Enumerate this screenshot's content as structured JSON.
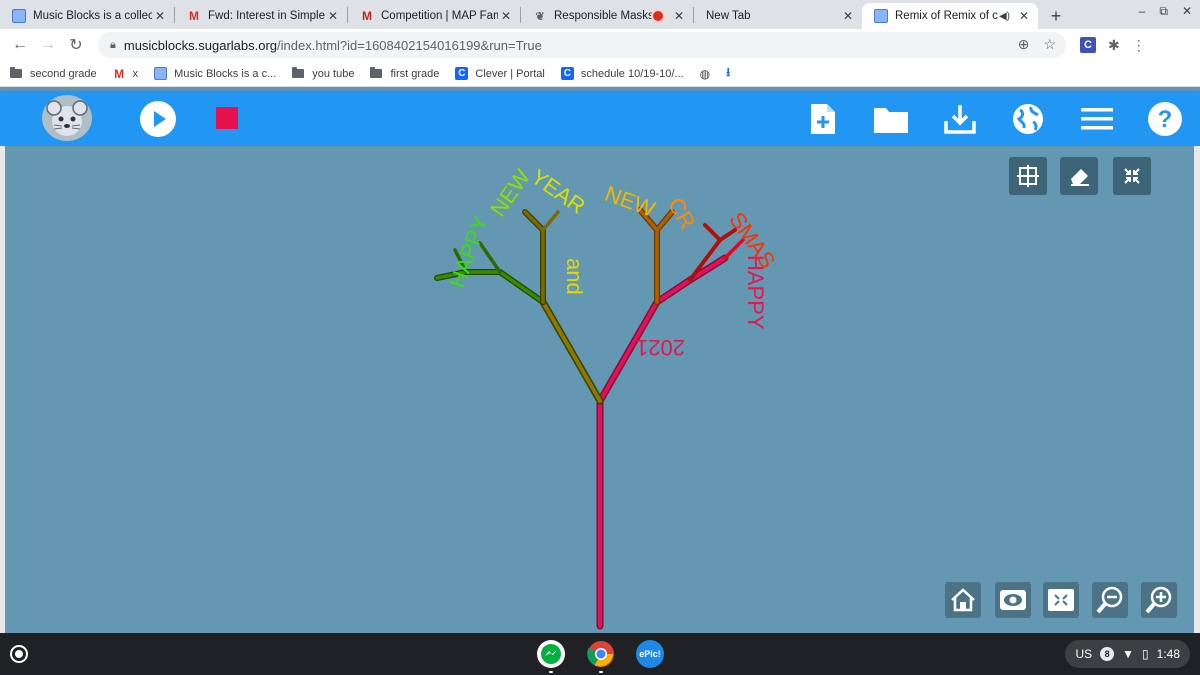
{
  "browser": {
    "tabs": [
      {
        "title": "Music Blocks is a collect",
        "favicon": "music-blocks-icon",
        "active": false
      },
      {
        "title": "Fwd: Interest in Simple C",
        "favicon": "gmail-icon",
        "active": false
      },
      {
        "title": "Competition | MAP Fam",
        "favicon": "map-icon",
        "active": false
      },
      {
        "title": "Responsible Masks",
        "favicon": "leaf-icon",
        "active": false,
        "recording": true
      },
      {
        "title": "New Tab",
        "favicon": "",
        "active": false
      },
      {
        "title": "Remix of Remix of c",
        "favicon": "music-blocks-icon",
        "active": true,
        "audio": true
      }
    ],
    "newtab_symbol": "+",
    "window_controls": [
      "‒",
      "⧉",
      "✕"
    ],
    "url_host": "musicblocks.sugarlabs.org",
    "url_path": "/index.html?id=1608402154016199&run=True",
    "bookmarks": [
      {
        "label": "second grade",
        "icon": "folder-icon"
      },
      {
        "label": "x",
        "icon": "gmail-icon"
      },
      {
        "label": "Music Blocks is a c...",
        "icon": "music-blocks-icon"
      },
      {
        "label": "you tube",
        "icon": "folder-icon"
      },
      {
        "label": "first grade",
        "icon": "folder-icon"
      },
      {
        "label": "Clever | Portal",
        "icon": "clever-icon"
      },
      {
        "label": "schedule 10/19-10/...",
        "icon": "clever-icon"
      }
    ]
  },
  "app": {
    "header_icons": [
      "new-project-icon",
      "open-folder-icon",
      "save-download-icon",
      "globe-icon",
      "menu-icon",
      "help-icon"
    ],
    "canvas_tools": [
      "grid-icon",
      "eraser-icon",
      "collapse-icon"
    ],
    "bottom_tools": [
      "home-icon",
      "eye-icon",
      "expand-icon",
      "zoom-out-icon",
      "zoom-in-icon"
    ],
    "canvas_text": {
      "and": "and",
      "happy": "HAPPY",
      "year": "2021",
      "w1": "HAPPY",
      "w2": "NEW",
      "w3": "YEAR",
      "w4": "CR",
      "w5": "SMAS"
    },
    "colors": {
      "header": "#2196f3",
      "canvas": "#6497b1",
      "trunk": "#d6124f",
      "stop": "#e8114f"
    }
  },
  "shelf": {
    "ime": "US",
    "notifications": "8",
    "time": "1:48",
    "apps": [
      "messenger-icon",
      "chrome-icon",
      "epic-icon"
    ],
    "epic_label": "ePic!"
  }
}
